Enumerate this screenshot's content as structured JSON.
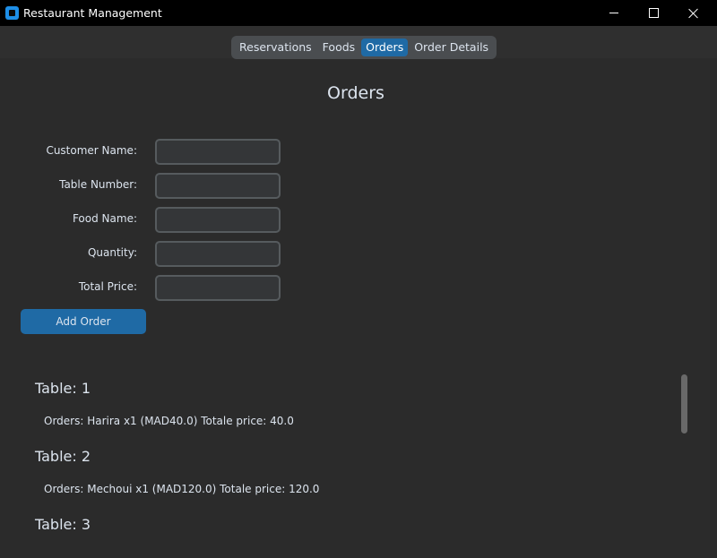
{
  "window": {
    "title": "Restaurant Management",
    "icons": {
      "app": "app-icon",
      "minimize": "minimize-icon",
      "maximize": "maximize-icon",
      "close": "close-icon"
    }
  },
  "tabs": [
    {
      "label": "Reservations",
      "active": false
    },
    {
      "label": "Foods",
      "active": false
    },
    {
      "label": "Orders",
      "active": true
    },
    {
      "label": "Order Details",
      "active": false
    }
  ],
  "page": {
    "title": "Orders"
  },
  "form": {
    "fields": [
      {
        "label": "Customer Name:",
        "value": ""
      },
      {
        "label": "Table Number:",
        "value": ""
      },
      {
        "label": "Food Name:",
        "value": ""
      },
      {
        "label": "Quantity:",
        "value": ""
      },
      {
        "label": "Total Price:",
        "value": ""
      }
    ],
    "submit_label": "Add Order"
  },
  "orders": [
    {
      "table": "Table: 1",
      "summary": "Orders: Harira x1 (MAD40.0) Totale price: 40.0"
    },
    {
      "table": "Table: 2",
      "summary": "Orders: Mechoui x1 (MAD120.0) Totale price: 120.0"
    },
    {
      "table": "Table: 3",
      "summary": ""
    }
  ],
  "colors": {
    "background": "#2b2b2b",
    "titlebar": "#000000",
    "accent": "#1f6aa5",
    "input_bg": "#343638",
    "input_border": "#565b5e",
    "tab_strip": "#4a4d50"
  }
}
